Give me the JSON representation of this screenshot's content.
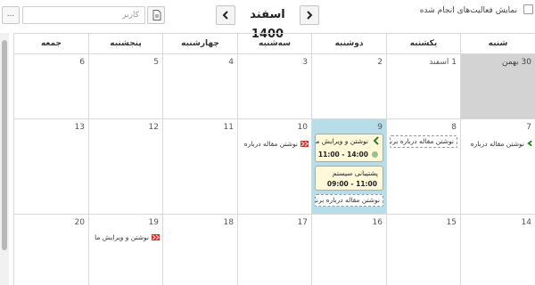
{
  "toolbar": {
    "more_label": "...",
    "user_placeholder": "کاربر",
    "month_title": "اسفند 1400",
    "show_done_label": "نمایش فعالیت‌های انجام شده"
  },
  "weekdays": [
    "شنبه",
    "یکشنبه",
    "دوشنبه",
    "سه‌شنبه",
    "چهارشنبه",
    "پنجشنبه",
    "جمعه"
  ],
  "weeks": [
    {
      "days": [
        "30 بهمن",
        "1 اسفند",
        "2",
        "3",
        "4",
        "5",
        "6"
      ]
    },
    {
      "days": [
        "7",
        "8",
        "9",
        "10",
        "11",
        "12",
        "13"
      ]
    },
    {
      "days": [
        "14",
        "15",
        "16",
        "17",
        "18",
        "19",
        "20"
      ]
    }
  ],
  "events": {
    "d7": "نوشتن مقاله درباره",
    "d8": "نوشتن مقاله درباره برنا",
    "d9_card1_title": "نوشتن و ویرایش مقا",
    "d9_card1_time": "14:00  -  11:00",
    "d9_card2_title": "پشتیبانی سیستم",
    "d9_card2_time": "11:00  -  09:00",
    "d9_box": "نوشتن مقاله درباره برنا",
    "d10": "نوشتن مقاله درباره",
    "d19": "نوشتن و ویرایش ما"
  },
  "colors": {
    "today_bg": "#b7dde8",
    "other_month_bg": "#d3d3d3",
    "chevron_green": "#2e7d1f",
    "flag_red": "#d0302a",
    "card_bg": "#fff9d9"
  },
  "icons": [
    "more-icon",
    "report-icon",
    "chevron-left-icon",
    "chevron-right-icon",
    "checkbox-icon",
    "chevron-left-icon",
    "flag-icon",
    "status-dot-icon"
  ]
}
